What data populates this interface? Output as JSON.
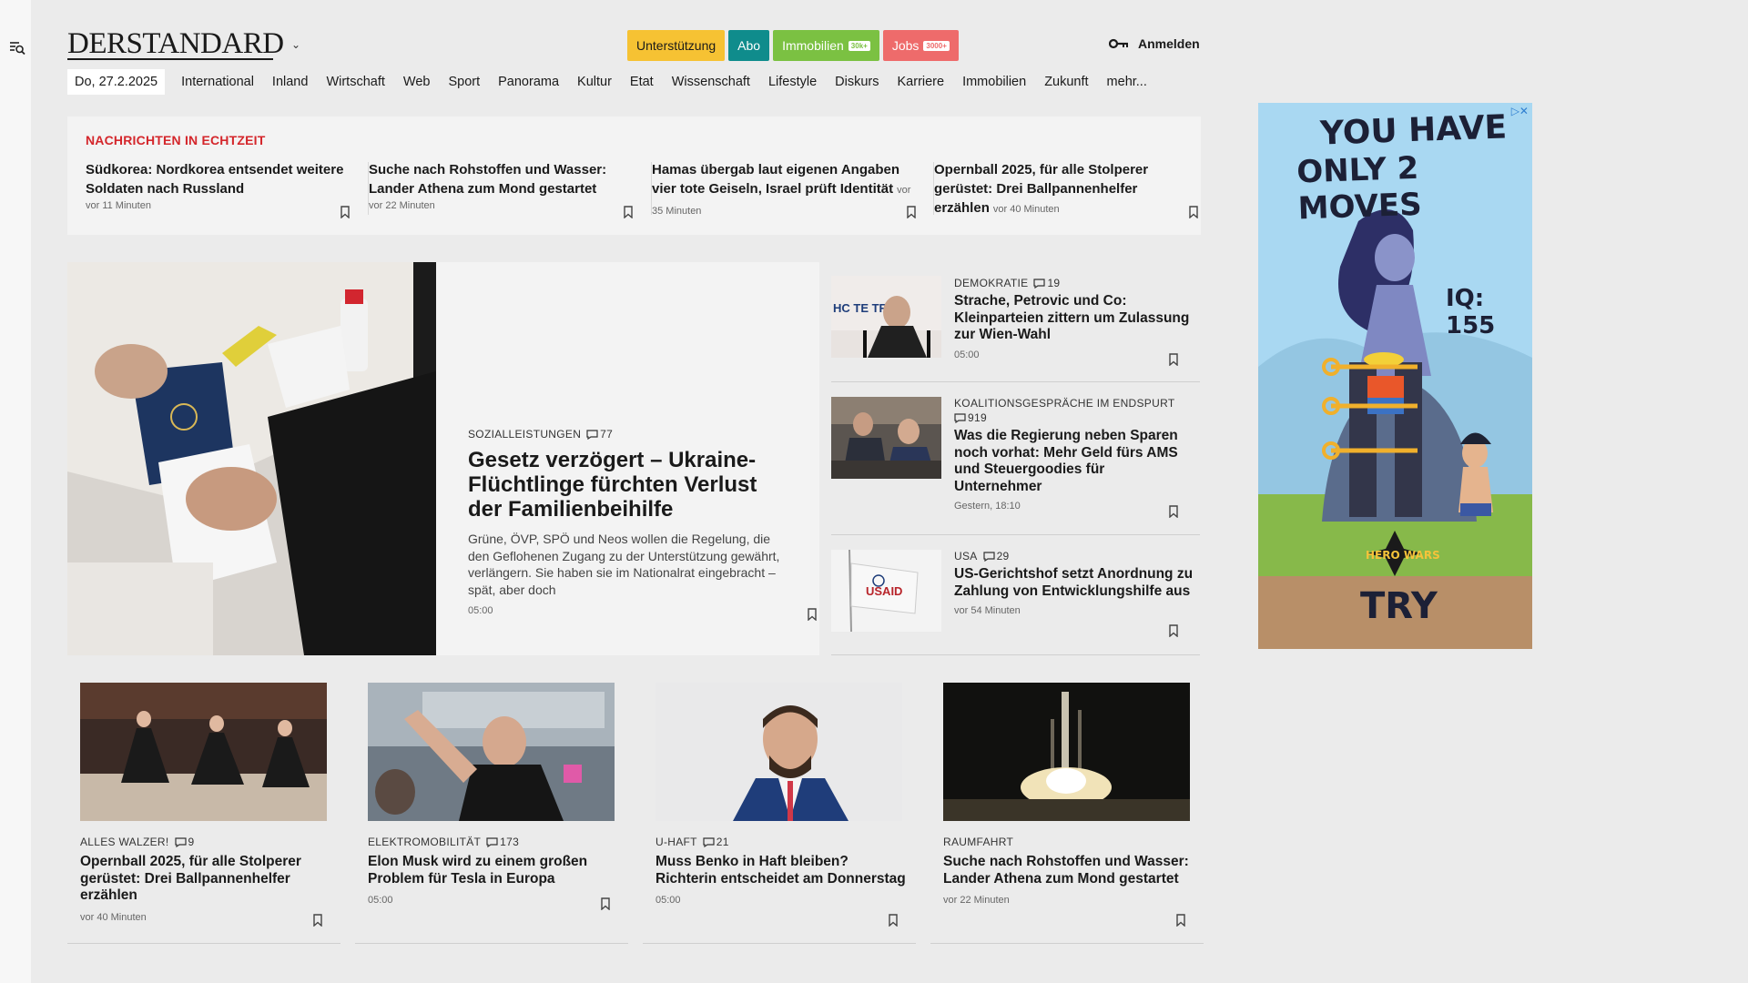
{
  "header": {
    "logo": "DERSTANDARD",
    "buttons": [
      {
        "label": "Unterstützung"
      },
      {
        "label": "Abo"
      },
      {
        "label": "Immobilien",
        "badge": "30k+"
      },
      {
        "label": "Jobs",
        "badge": "3000+"
      }
    ],
    "login_label": "Anmelden"
  },
  "nav": {
    "date": "Do, 27.2.2025",
    "items": [
      "International",
      "Inland",
      "Wirtschaft",
      "Web",
      "Sport",
      "Panorama",
      "Kultur",
      "Etat",
      "Wissenschaft",
      "Lifestyle",
      "Diskurs",
      "Karriere",
      "Immobilien",
      "Zukunft",
      "mehr..."
    ]
  },
  "ticker": {
    "title": "NACHRICHTEN IN ECHTZEIT",
    "items": [
      {
        "title": "Südkorea: Nordkorea entsendet weitere Soldaten nach Russland",
        "time": "vor 11 Minuten"
      },
      {
        "title": "Suche nach Rohstoffen und Wasser: Lander Athena zum Mond gestartet",
        "time": "vor 22 Minuten"
      },
      {
        "title": "Hamas übergab laut eigenen Angaben vier tote Geiseln, Israel prüft Identität",
        "time": "vor 35 Minuten"
      },
      {
        "title": "Opernball 2025, für alle Stolperer gerüstet: Drei Ballpannenhelfer erzählen",
        "time": "vor 40 Minuten"
      }
    ]
  },
  "lead": {
    "kicker": "SOZIALLEISTUNGEN",
    "comments": "77",
    "title": "Gesetz verzögert – Ukraine-Flüchtlinge fürchten Verlust der Familienbeihilfe",
    "teaser": "Grüne, ÖVP, SPÖ und Neos wollen die Regelung, die den Geflohenen Zugang zu der Unterstützung gewährt, verlängern. Sie haben sie im Nationalrat eingebracht – spät, aber doch",
    "time": "05:00"
  },
  "side": [
    {
      "kicker": "DEMOKRATIE",
      "comments": "19",
      "title": "Strache, Petrovic und Co: Kleinparteien zittern um Zulassung zur Wien-Wahl",
      "time": "05:00",
      "img_text": "HC TE TRAC"
    },
    {
      "kicker": "KOALITIONSGESPRÄCHE IM ENDSPURT",
      "comments": "919",
      "title": "Was die Regierung neben Sparen noch vorhat: Mehr Geld fürs AMS und Steuergoodies für Unternehmer",
      "time": "Gestern, 18:10"
    },
    {
      "kicker": "USA",
      "comments": "29",
      "title": "US-Gerichtshof setzt Anordnung zu Zahlung von Entwicklungshilfe aus",
      "time": "vor 54 Minuten",
      "img_text": "USAID"
    }
  ],
  "cards": [
    {
      "kicker": "ALLES WALZER!",
      "comments": "9",
      "title": "Opernball 2025, für alle Stolperer gerüstet: Drei Ballpannenhelfer erzählen",
      "time": "vor 40 Minuten"
    },
    {
      "kicker": "ELEKTROMOBILITÄT",
      "comments": "173",
      "title": "Elon Musk wird zu einem großen Problem für Tesla in Europa",
      "time": "05:00"
    },
    {
      "kicker": "U-HAFT",
      "comments": "21",
      "title": "Muss Benko in Haft bleiben? Richterin entscheidet am Donnerstag",
      "time": "05:00"
    },
    {
      "kicker": "RAUMFAHRT",
      "comments": "",
      "title": "Suche nach Rohstoffen und Wasser: Lander Athena zum Mond gestartet",
      "time": "vor 22 Minuten"
    }
  ],
  "ad": {
    "line1": "YOU HAVE",
    "line2": "ONLY 2 MOVES",
    "iq": "IQ: 155",
    "brand": "HERO WARS",
    "cta": "TRY"
  }
}
